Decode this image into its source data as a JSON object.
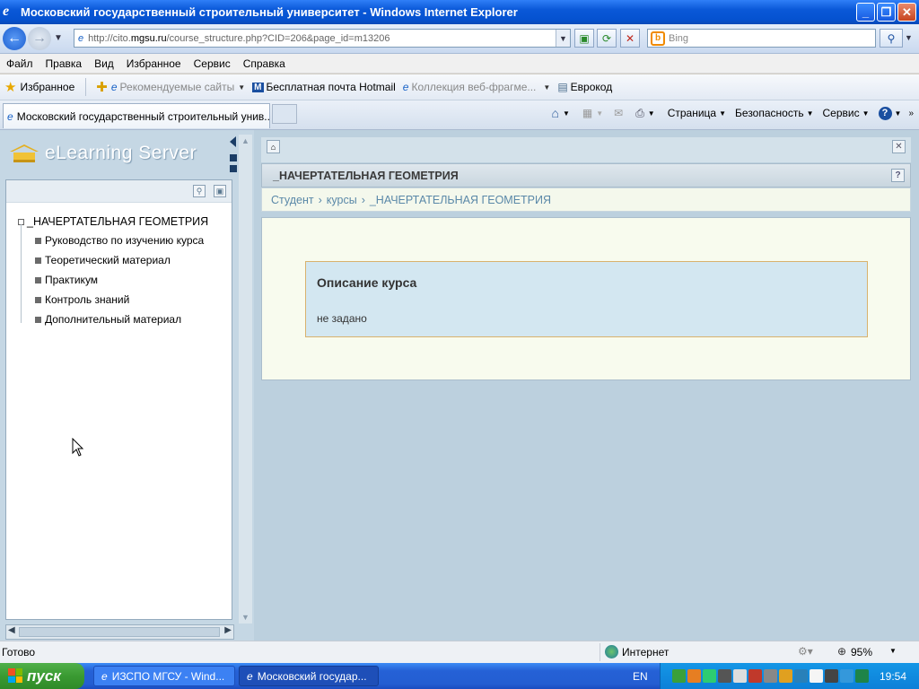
{
  "window": {
    "title": "Московский государственный строительный университет - Windows Internet Explorer",
    "icon": "ie-icon"
  },
  "nav": {
    "url_prefix": "http://cito.",
    "url_host": "mgsu.ru",
    "url_path": "/course_structure.php?CID=206&page_id=m13206",
    "search_placeholder": "Bing"
  },
  "menu": [
    "Файл",
    "Правка",
    "Вид",
    "Избранное",
    "Сервис",
    "Справка"
  ],
  "favorites": {
    "label": "Избранное",
    "items": [
      {
        "label": "Рекомендуемые сайты",
        "dim": true
      },
      {
        "label": "Бесплатная почта Hotmail",
        "dim": false
      },
      {
        "label": "Коллекция веб-фрагме...",
        "dim": true
      },
      {
        "label": "Еврокод",
        "dim": false
      }
    ]
  },
  "tabs": {
    "active": "Московский государственный строительный унив..."
  },
  "tools": {
    "page": "Страница",
    "safety": "Безопасность",
    "service": "Сервис"
  },
  "sidebar": {
    "logo": "eLearning Server",
    "root": "_НАЧЕРТАТЕЛЬНАЯ ГЕОМЕТРИЯ",
    "items": [
      "Руководство по изучению курса",
      "Теоретический материал",
      "Практикум",
      "Контроль знаний",
      "Дополнительный материал"
    ]
  },
  "main": {
    "course_title": "_НАЧЕРТАТЕЛЬНАЯ ГЕОМЕТРИЯ",
    "breadcrumb": [
      "Студент",
      "›",
      "курсы",
      "›",
      "_НАЧЕРТАТЕЛЬНАЯ ГЕОМЕТРИЯ"
    ],
    "desc_title": "Описание курса",
    "desc_value": "не задано"
  },
  "status": {
    "left": "Готово",
    "zone": "Интернет",
    "zoom": "95%"
  },
  "taskbar": {
    "start": "пуск",
    "buttons": [
      "ИЗСПО МГСУ - Wind...",
      "Московский государ..."
    ],
    "lang": "EN",
    "time": "19:54"
  },
  "colors": {
    "titlebar": "#0a58d8",
    "content_bg": "#bcd0de",
    "accent_link": "#5a88a8",
    "desc_border": "#d8b26d"
  }
}
